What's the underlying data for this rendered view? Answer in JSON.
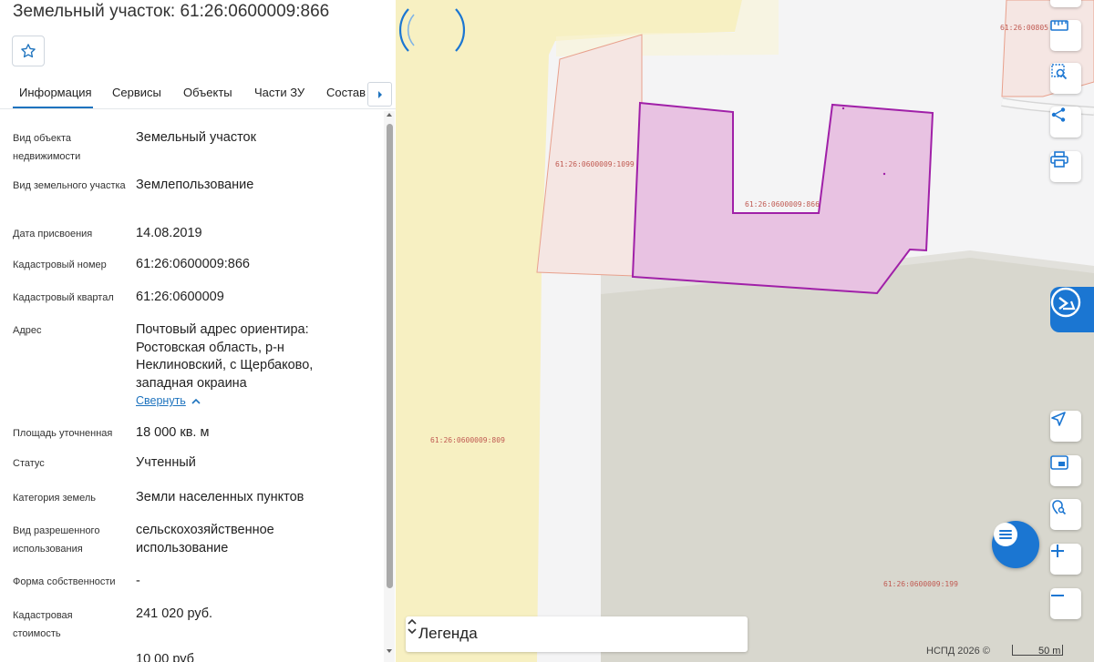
{
  "header": {
    "title": "Земельный участок: 61:26:0600009:866"
  },
  "favorite": {
    "icon": "star-outline-icon"
  },
  "tabs": [
    {
      "label": "Информация",
      "active": true
    },
    {
      "label": "Сервисы"
    },
    {
      "label": "Объекты"
    },
    {
      "label": "Части ЗУ"
    },
    {
      "label": "Состав"
    }
  ],
  "fields": [
    {
      "label": "Вид объекта недвижимости",
      "value": "Земельный участок"
    },
    {
      "label": "Вид земельного участка",
      "value": "Землепользование"
    },
    {
      "label": "Дата присвоения",
      "value": "14.08.2019"
    },
    {
      "label": "Кадастровый номер",
      "value": "61:26:0600009:866"
    },
    {
      "label": "Кадастровый квартал",
      "value": "61:26:0600009"
    },
    {
      "label": "Адрес",
      "value": "Почтовый адрес ориентира: Ростовская область, р-н Неклиновский, с Щербаково, западная окраина"
    },
    {
      "label": "Площадь уточненная",
      "value": "18 000 кв. м"
    },
    {
      "label": "Статус",
      "value": "Учтенный"
    },
    {
      "label": "Категория земель",
      "value": "Земли населенных пунктов"
    },
    {
      "label": "Вид разрешенного использования",
      "value": "сельскохозяйственное использование"
    },
    {
      "label": "Форма собственности",
      "value": "-"
    },
    {
      "label": "Кадастровая стоимость",
      "value": "241 020 руб."
    }
  ],
  "collapse_link": "Свернуть",
  "truncated_value": "10 00 руб",
  "map": {
    "parcels": [
      {
        "id": "61:26:0600009:1099"
      },
      {
        "id": "61:26:0600009:866"
      },
      {
        "id": "61:26:0600009:809"
      },
      {
        "id": "61:26:0600009:199"
      },
      {
        "id": "61:26:00805"
      }
    ],
    "colors": {
      "selected_fill": "#e8c2e2",
      "selected_stroke": "#a020a8",
      "parcel_fill": "#f5e6e3",
      "parcel_stroke": "#e8a08c",
      "yellow": "#f7f0c2",
      "grey": "#d8d7ce",
      "accent": "#1b76d2"
    },
    "legend_label": "Легенда",
    "attribution": "НСПД 2026 ©",
    "scale_label": "50 m"
  }
}
